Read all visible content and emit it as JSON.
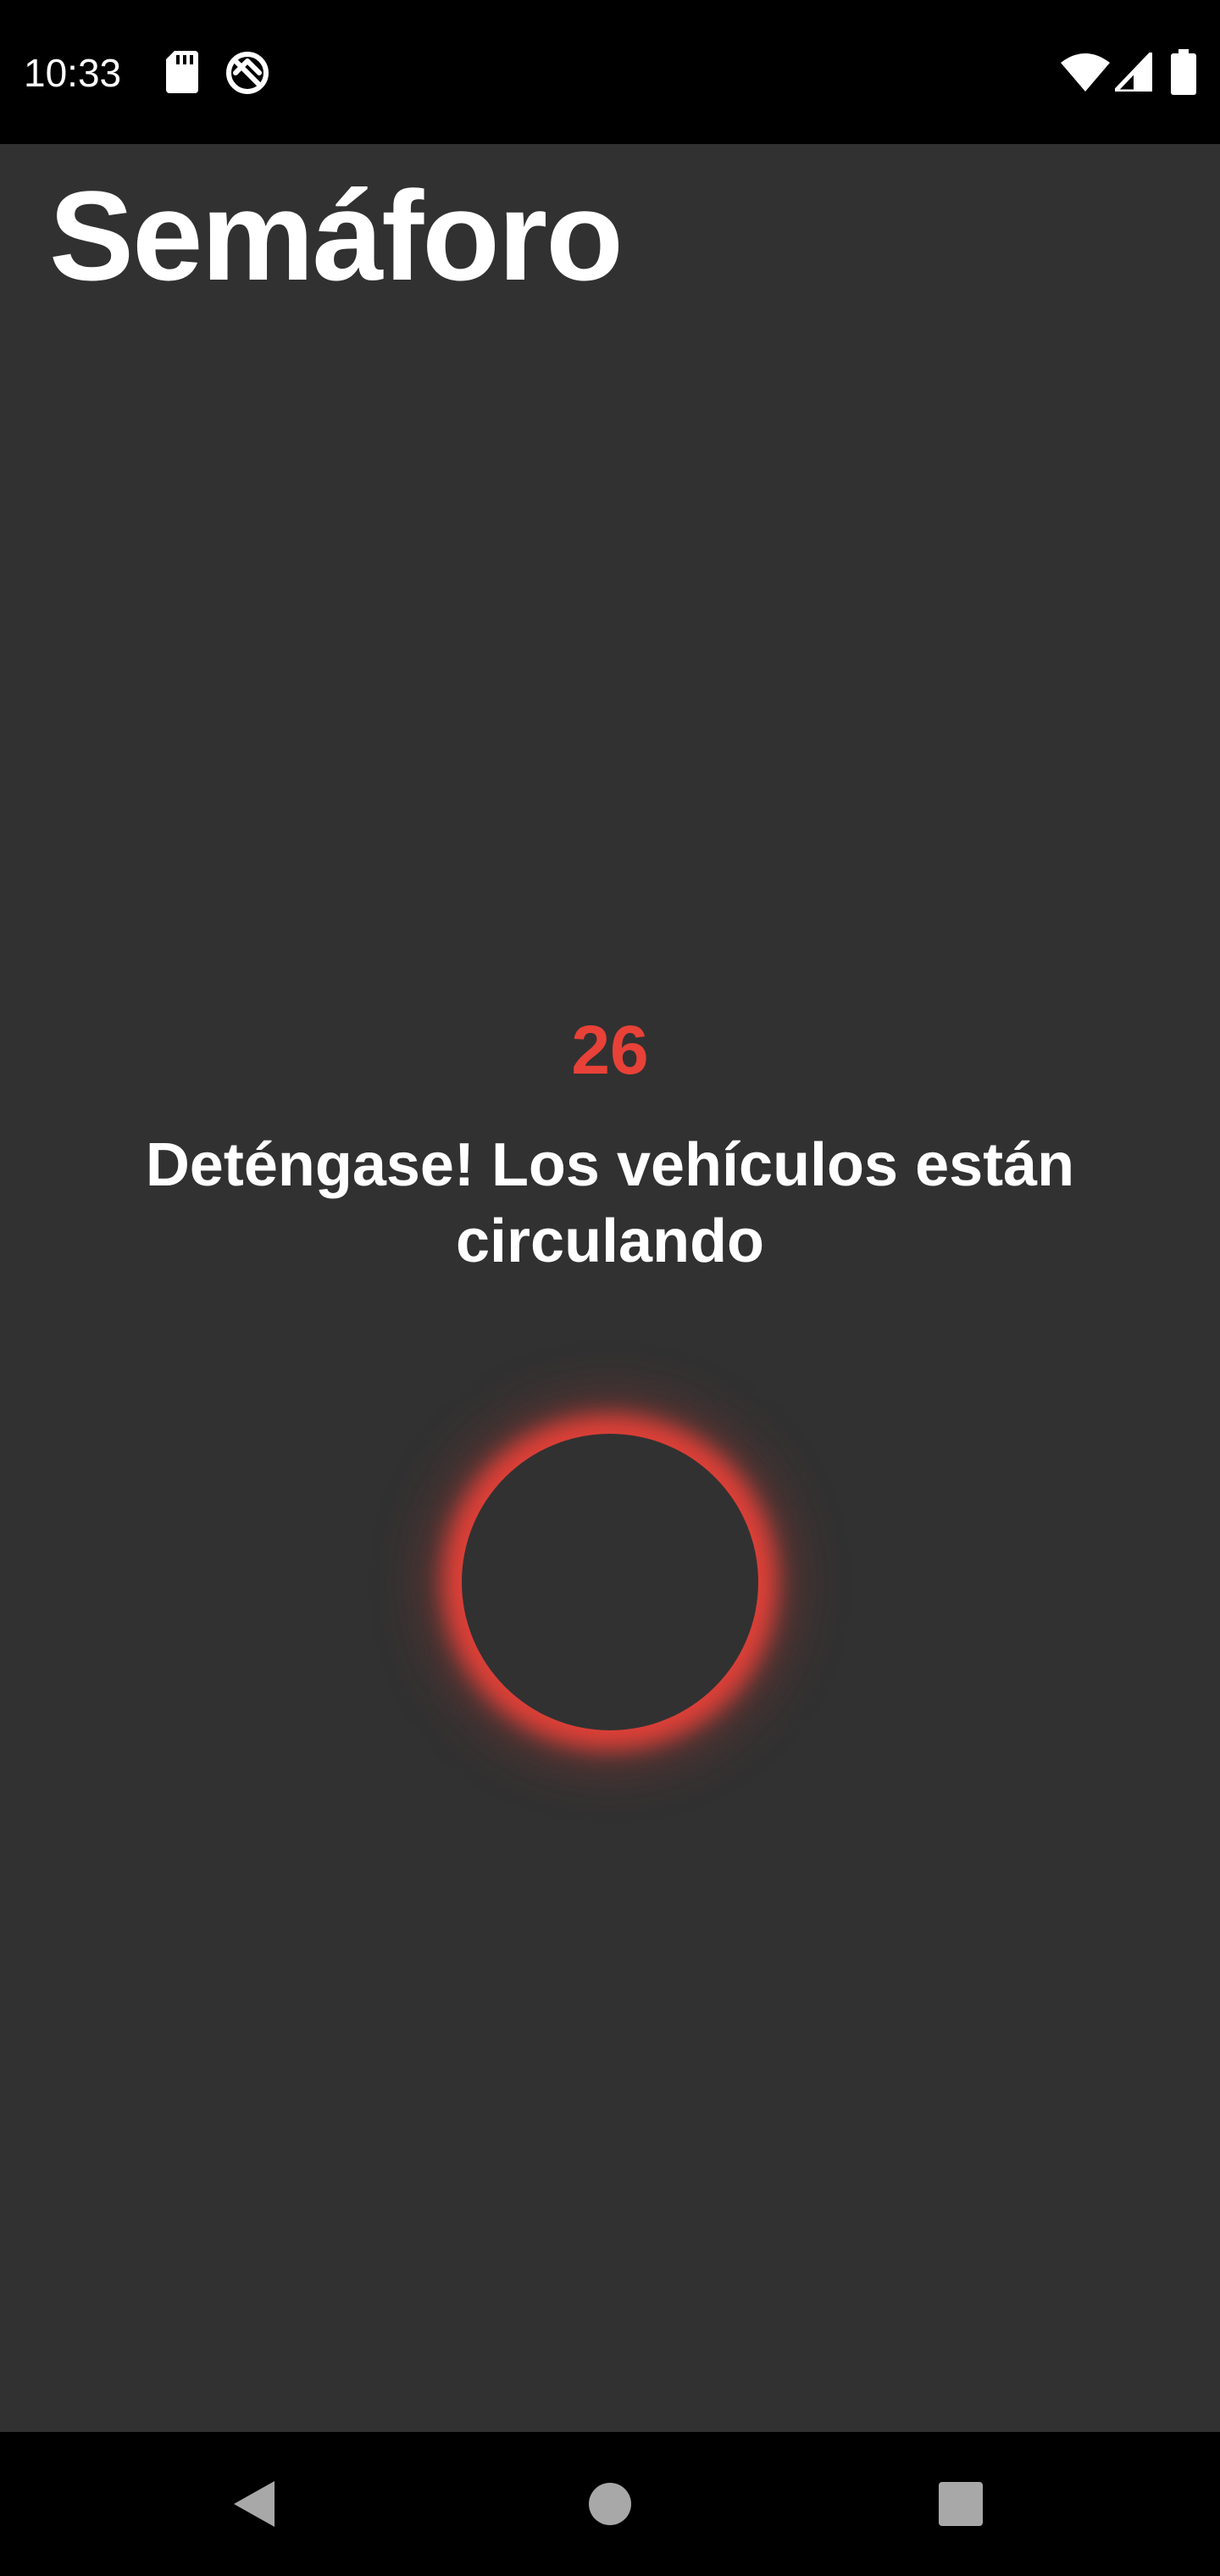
{
  "status_bar": {
    "time": "10:33",
    "left_icons": [
      "sd-card-icon",
      "data-saver-icon"
    ],
    "right_icons": [
      "wifi-icon",
      "cell-signal-icon",
      "battery-icon"
    ]
  },
  "app": {
    "title": "Semáforo",
    "countdown": "26",
    "message": "Deténgase! Los vehículos están circulando",
    "light_state": "red"
  },
  "colors": {
    "background": "#313131",
    "accent_red": "#E84138",
    "text": "#FFFFFF",
    "system_bars": "#000000"
  },
  "nav_bar": {
    "icons": [
      "back-icon",
      "home-icon",
      "recents-icon"
    ]
  }
}
